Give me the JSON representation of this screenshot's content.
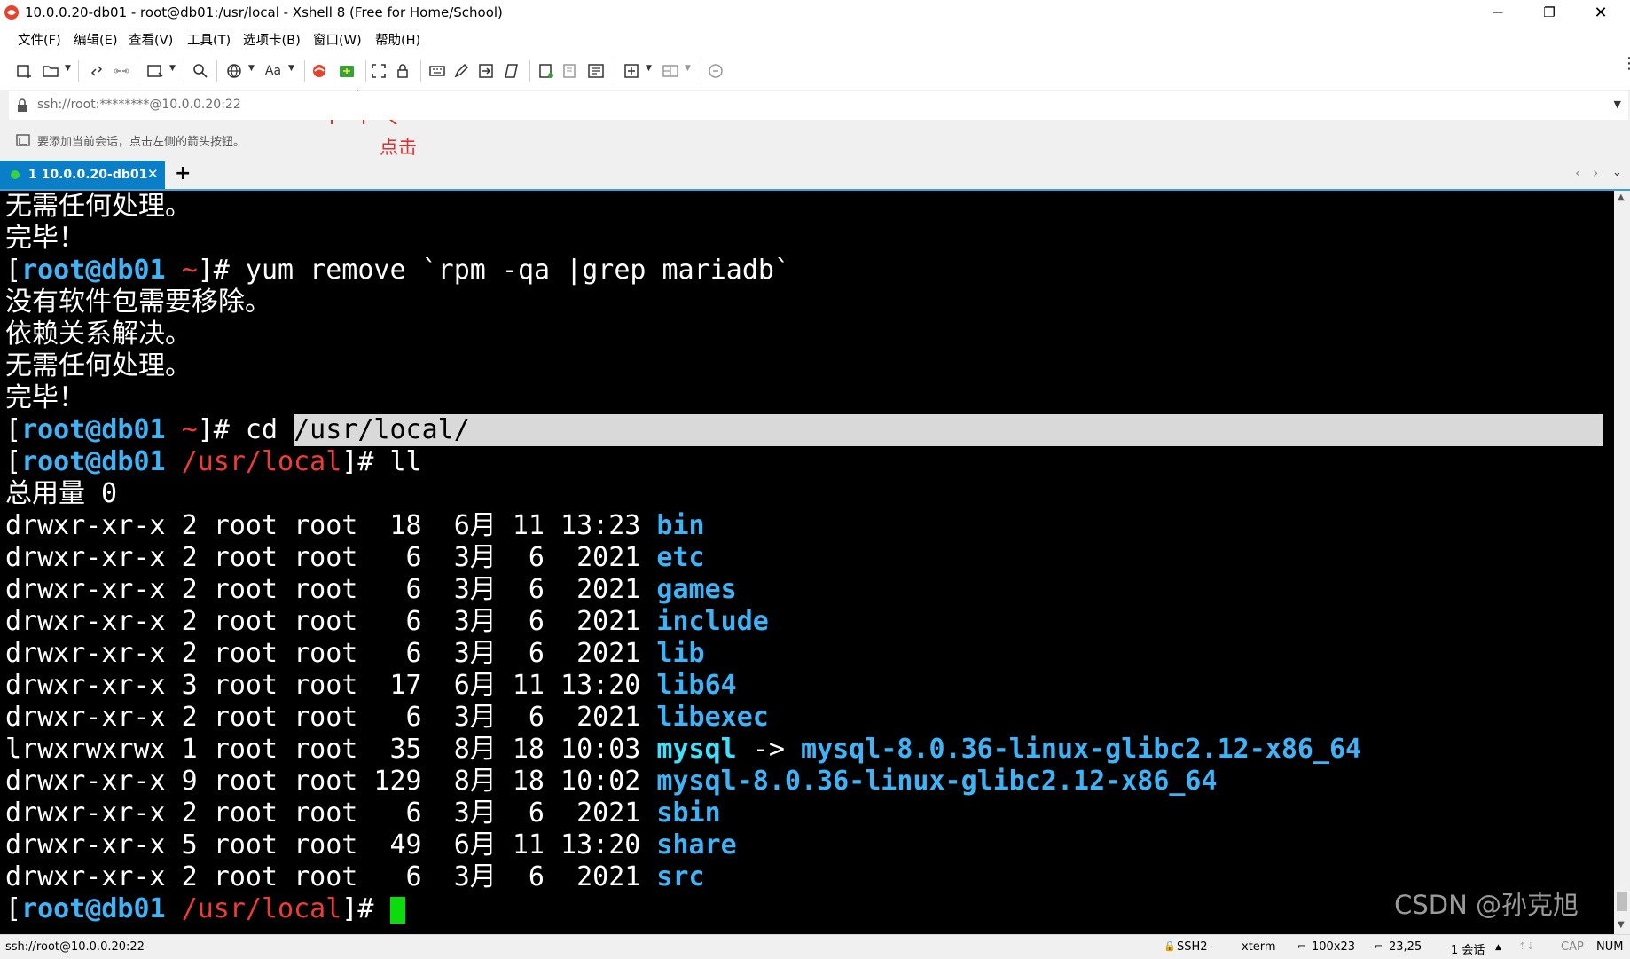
{
  "window": {
    "title": "10.0.0.20-db01 - root@db01:/usr/local - Xshell 8 (Free for Home/School)",
    "minimize": "─",
    "maximize": "❐",
    "close": "✕"
  },
  "menu": [
    "文件(F)",
    "编辑(E)",
    "查看(V)",
    "工具(T)",
    "选项卡(B)",
    "窗口(W)",
    "帮助(H)"
  ],
  "address": {
    "value": "ssh://root:********@10.0.0.20:22"
  },
  "hint": "要添加当前会话，点击左侧的箭头按钮。",
  "annotation": {
    "label": "点击",
    "color": "#e03131"
  },
  "tabs": [
    {
      "label": "1 10.0.0.20-db01",
      "status_color": "#3ad23a"
    }
  ],
  "terminal": {
    "lines": [
      "无需任何处理。",
      "完毕！",
      "[root@db01 ~]# yum remove `rpm -qa |grep mariadb`",
      "没有软件包需要移除。",
      "依赖关系解决。",
      "无需任何处理。",
      "完毕！",
      "[root@db01 ~]# cd /usr/local/",
      "[root@db01 /usr/local]# ll",
      "总用量 0",
      "drwxr-xr-x 2 root root  18  6月 11 13:23 bin",
      "drwxr-xr-x 2 root root   6  3月  6  2021 etc",
      "drwxr-xr-x 2 root root   6  3月  6  2021 games",
      "drwxr-xr-x 2 root root   6  3月  6  2021 include",
      "drwxr-xr-x 2 root root   6  3月  6  2021 lib",
      "drwxr-xr-x 3 root root  17  6月 11 13:20 lib64",
      "drwxr-xr-x 2 root root   6  3月  6  2021 libexec",
      "lrwxrwxrwx 1 root root  35  8月 18 10:03 mysql -> mysql-8.0.36-linux-glibc2.12-x86_64",
      "drwxr-xr-x 9 root root 129  8月 18 10:02 mysql-8.0.36-linux-glibc2.12-x86_64",
      "drwxr-xr-x 2 root root   6  3月  6  2021 sbin",
      "drwxr-xr-x 5 root root  49  6月 11 13:20 share",
      "drwxr-xr-x 2 root root   6  3月  6  2021 src",
      "[root@db01 /usr/local]# "
    ],
    "watermark": "CSDN @孙克旭"
  },
  "status": {
    "connection": "ssh://root@10.0.0.20:22",
    "protocol": "SSH2",
    "term": "xterm",
    "size": "100x23",
    "cursor_pos": "23,25",
    "sessions": "1 会话",
    "cap": "CAP",
    "num": "NUM"
  },
  "colors": {
    "terminal_bg": "#000000",
    "prompt_user": "#3fb3f5",
    "prompt_path": "#ee3a3a",
    "directory": "#3fb3f5",
    "symlink": "#40e0ff",
    "cursor": "#0bdc0b",
    "tab_active": "#0a7fc7"
  }
}
